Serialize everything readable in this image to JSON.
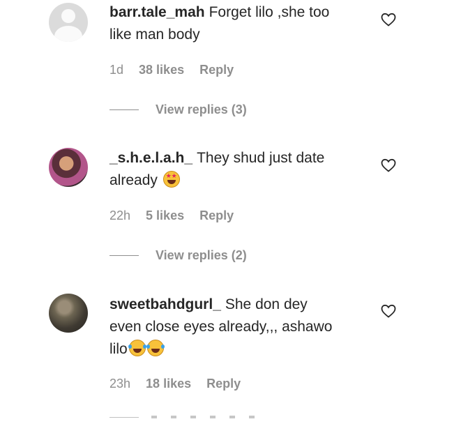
{
  "comments": [
    {
      "username": "barr.tale_mah",
      "text_line1": "Forget lilo ,she too",
      "text_line2": "like man body",
      "time": "1d",
      "likes": "38 likes",
      "reply_label": "Reply",
      "view_replies": "View replies (3)",
      "avatar": "default-avatar"
    },
    {
      "username": "_s.h.e.l.a.h_",
      "text_line1": "They shud just date",
      "text_line2": "already",
      "emoji": "star-struck-emoji",
      "time": "22h",
      "likes": "5 likes",
      "reply_label": "Reply",
      "view_replies": "View replies (2)",
      "avatar": "photo-avatar"
    },
    {
      "username": "sweetbahdgurl_",
      "text_line1": "She don dey",
      "text_line2": "even close eyes already,,, ashawo",
      "text_line3": "lilo",
      "emoji": "tears-of-joy-emoji",
      "time": "23h",
      "likes": "18 likes",
      "reply_label": "Reply",
      "avatar": "photo-avatar"
    }
  ],
  "colors": {
    "text": "#262626",
    "secondary": "#8e8e8e",
    "background": "#ffffff"
  },
  "icons": [
    "heart-outline-icon"
  ]
}
